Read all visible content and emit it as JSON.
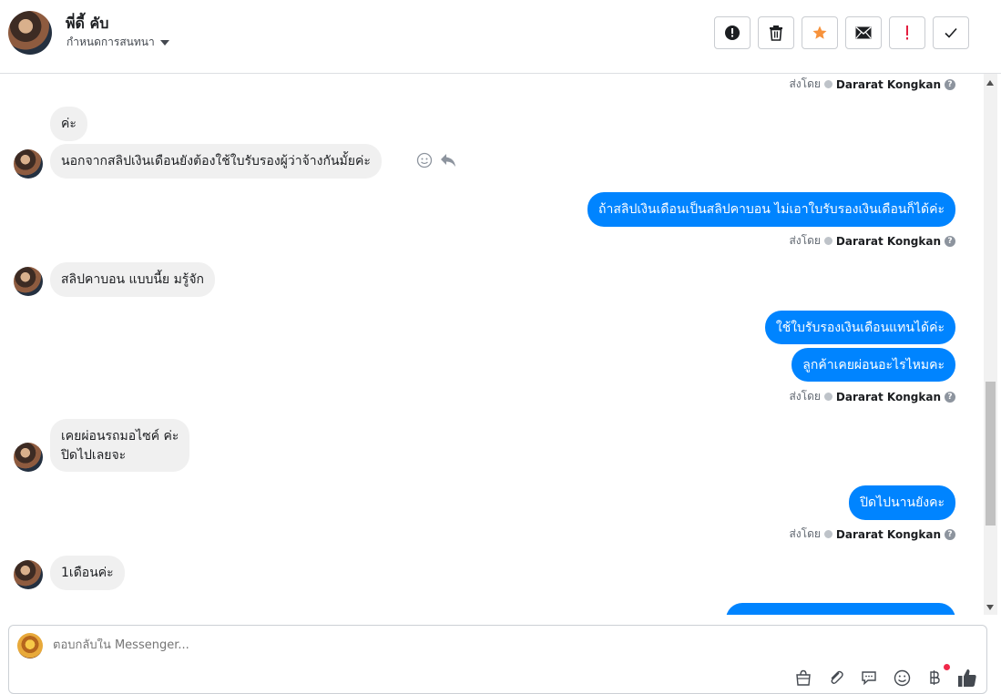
{
  "header": {
    "contact_name": "พี่ดี้ คับ",
    "assign_label": "กำหนดการสนทนา",
    "toolbar": [
      {
        "name": "mark-spam-button",
        "icon": "alert-circle-icon"
      },
      {
        "name": "delete-button",
        "icon": "trash-icon"
      },
      {
        "name": "star-button",
        "icon": "star-icon"
      },
      {
        "name": "mark-unread-button",
        "icon": "envelope-icon"
      },
      {
        "name": "follow-up-button",
        "icon": "exclamation-icon"
      },
      {
        "name": "mark-done-button",
        "icon": "checkmark-icon"
      }
    ]
  },
  "messages": {
    "sent_by_label": "ส่งโดย",
    "agent_name": "Dararat Kongkan",
    "m1": "ค่ะ",
    "m2": "นอกจากสลิปเงินเดือนยังต้องใช้ใบรับรองผู้ว่าจ้างกันมั้ยค่ะ",
    "m3": "ถ้าสลิปเงินเดือนเป็นสลิปคาบอน ไม่เอาใบรับรองเงินเดือนก็ได้ค่ะ",
    "m4": "สลิปคาบอน แบบนี้ย มรู้จัก",
    "m5": "ใช้ใบรับรองเงินเดือนแทนได้ค่ะ",
    "m6": "ลูกค้าเคยผ่อนอะไรไหมคะ",
    "m7_line1": "เคยผ่อนรถมอไซค์ ค่ะ",
    "m7_line2": "ปิดไปเลยจะ",
    "m8": "ปิดไปนานยังคะ",
    "m9": "1เดือนค่ะ"
  },
  "composer": {
    "placeholder": "ตอบกลับใน Messenger..."
  },
  "colors": {
    "outgoing_bubble": "#0084ff",
    "incoming_bubble": "#f0f0f0",
    "star": "#f7923b",
    "follow_up": "#e41e3f"
  }
}
